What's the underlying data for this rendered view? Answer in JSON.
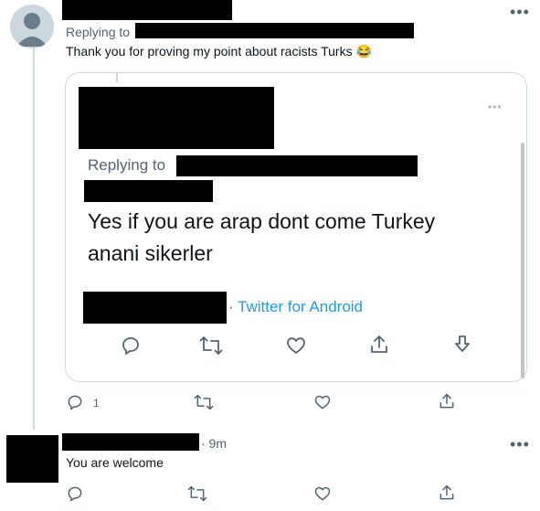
{
  "tweet1": {
    "replying_prefix": "Replying to",
    "text": "Thank you for proving my point about racists Turks 😂",
    "more": "•••",
    "actions": {
      "reply_count": "1"
    }
  },
  "quoted": {
    "more": "•••",
    "replying_prefix": "Replying to",
    "text_line1": "Yes if you are arap dont come Turkey",
    "text_line2": "anani sikerler",
    "source": "Twitter for Android",
    "dot": "·"
  },
  "tweet2": {
    "time": "· 9m",
    "text": "You are welcome",
    "more": "•••"
  }
}
